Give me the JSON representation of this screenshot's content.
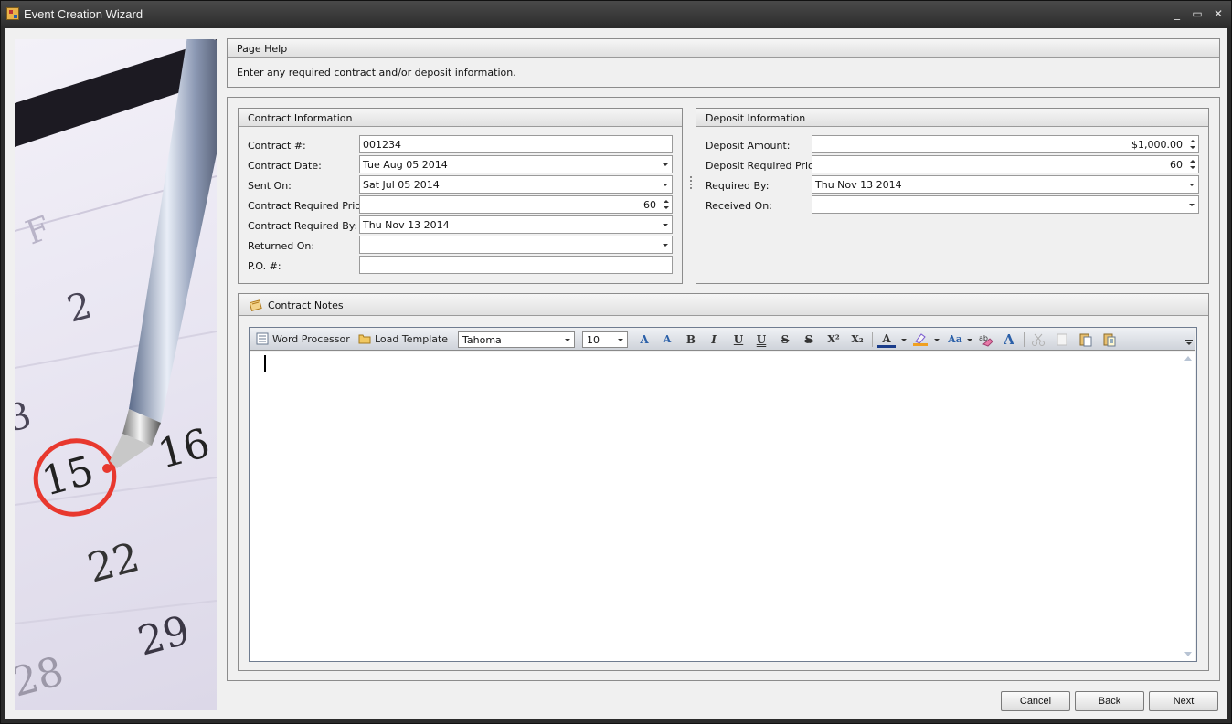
{
  "window": {
    "title": "Event Creation Wizard",
    "minimize_label": "_",
    "maximize_label": "▭",
    "close_label": "✕"
  },
  "side_image": {
    "numbers": [
      "F",
      "2",
      "3",
      "15",
      "16",
      "22",
      "29",
      "28"
    ],
    "circle_color": "#e8382e"
  },
  "page_help": {
    "header": "Page Help",
    "text": "Enter any required contract and/or deposit information."
  },
  "contract_info": {
    "header": "Contract Information",
    "contract_no": {
      "label": "Contract #:",
      "value": "001234"
    },
    "contract_date": {
      "label": "Contract Date:",
      "value": "Tue Aug 05 2014"
    },
    "sent_on": {
      "label": "Sent On:",
      "value": "Sat Jul 05 2014"
    },
    "required_prior": {
      "label": "Contract Required Prior:",
      "value": "60"
    },
    "required_by": {
      "label": "Contract Required By:",
      "value": "Thu Nov 13 2014"
    },
    "returned_on": {
      "label": "Returned On:",
      "value": ""
    },
    "po_no": {
      "label": "P.O. #:",
      "value": ""
    }
  },
  "deposit_info": {
    "header": "Deposit Information",
    "amount": {
      "label": "Deposit Amount:",
      "value": "$1,000.00"
    },
    "required_prior": {
      "label": "Deposit Required Prior:",
      "value": "60"
    },
    "required_by": {
      "label": "Required By:",
      "value": "Thu Nov 13 2014"
    },
    "received_on": {
      "label": "Received On:",
      "value": ""
    }
  },
  "contract_notes": {
    "header": "Contract Notes",
    "toolbar": {
      "word_processor": "Word Processor",
      "load_template": "Load Template",
      "font_family": "Tahoma",
      "font_size": "10",
      "grow_font": "A",
      "shrink_font": "A",
      "bold": "B",
      "italic": "I",
      "underline": "U",
      "double_underline": "U",
      "strikethrough": "S",
      "double_strikethrough": "S",
      "superscript": "X²",
      "subscript": "X₂",
      "font_color": "A",
      "change_case": "Aa",
      "clear_format": "A"
    },
    "editor_text": ""
  },
  "buttons": {
    "cancel": "Cancel",
    "back": "Back",
    "next": "Next"
  }
}
